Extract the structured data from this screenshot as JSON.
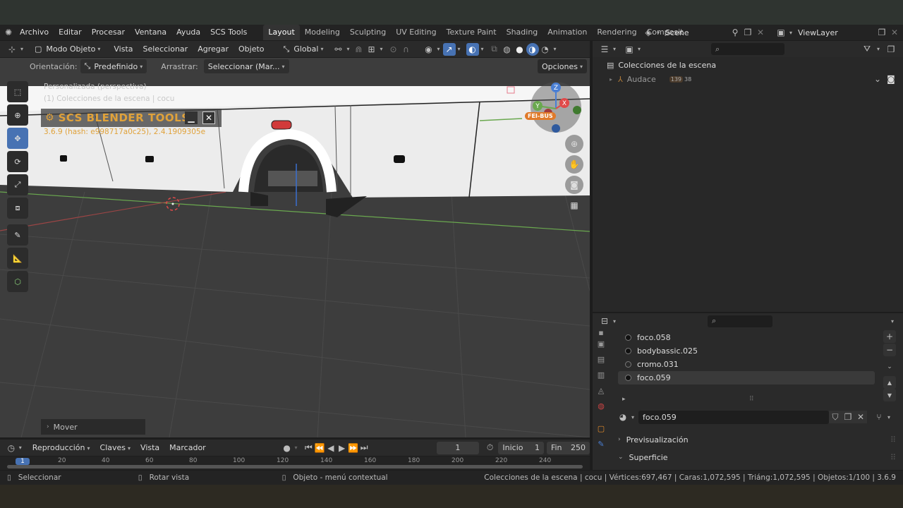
{
  "topbar": {
    "menus": [
      "Archivo",
      "Editar",
      "Procesar",
      "Ventana",
      "Ayuda",
      "SCS Tools"
    ],
    "workspaces": [
      "Layout",
      "Modeling",
      "Sculpting",
      "UV Editing",
      "Texture Paint",
      "Shading",
      "Animation",
      "Rendering",
      "Composit"
    ],
    "active_workspace": "Layout",
    "scene": "Scene",
    "view_layer": "ViewLayer"
  },
  "viewport": {
    "mode": "Modo Objeto",
    "menus": [
      "Vista",
      "Seleccionar",
      "Agregar",
      "Objeto"
    ],
    "transform": "Global",
    "orientation_label": "Orientación:",
    "orientation_value": "Predefinido",
    "drag_label": "Arrastrar:",
    "drag_value": "Seleccionar (Mar...",
    "options": "Opciones",
    "overlay_line1": "Personalizada (perspectiva)",
    "overlay_line2": "(1) Colecciones de la escena | cocu",
    "scs_title": "SCS BLENDER TOOLS",
    "scs_version": "3.6.9 (hash: e998717a0c25), 2.4.1909305e",
    "last_op": "Mover",
    "badge": "FEI-BUS"
  },
  "outliner": {
    "root": "Colecciones de la escena",
    "child": "Audace",
    "child_count": "139",
    "child_count2": "38"
  },
  "materials": {
    "items": [
      "foco.058",
      "bodybassic.025",
      "cromo.031",
      "foco.059"
    ],
    "selected": "foco.059",
    "panels": [
      "Previsualización",
      "Superficie"
    ]
  },
  "timeline": {
    "menus": [
      "Reproducción",
      "Claves",
      "Vista",
      "Marcador"
    ],
    "current_frame": "1",
    "start_label": "Inicio",
    "start": "1",
    "end_label": "Fin",
    "end": "250",
    "ticks": [
      "20",
      "40",
      "60",
      "80",
      "100",
      "120",
      "140",
      "160",
      "180",
      "200",
      "220",
      "240"
    ],
    "playhead": "1"
  },
  "statusbar": {
    "select": "Seleccionar",
    "rotate": "Rotar vista",
    "context": "Objeto - menú contextual",
    "stats": "Colecciones de la escena | cocu | Vértices:697,467 | Caras:1,072,595 | Triáng:1,072,595 | Objetos:1/100 | 3.6.9"
  },
  "colors": {
    "accent": "#4772b3",
    "axis_x": "#e04a4a",
    "axis_y": "#6aa84f",
    "axis_z": "#4a7fd4",
    "scs_title": "#e0a23a"
  }
}
